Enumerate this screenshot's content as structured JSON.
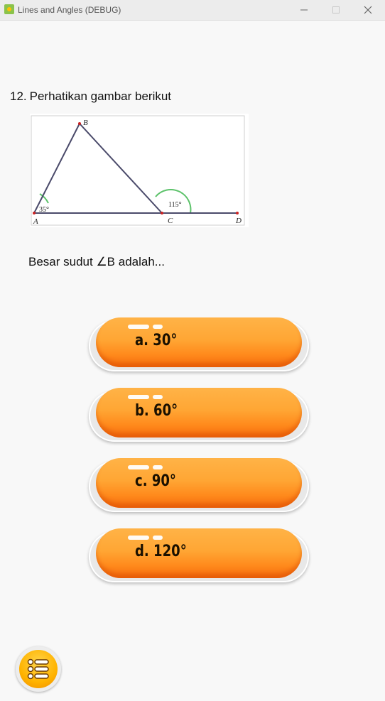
{
  "window": {
    "title": "Lines and Angles (DEBUG)",
    "icons": {
      "app": "app-icon",
      "minimize": "minimize-icon",
      "maximize": "maximize-icon",
      "close": "close-icon"
    }
  },
  "question": {
    "number": "12.",
    "text": "Perhatikan gambar berikut",
    "prompt": "Besar sudut  ∠B adalah..."
  },
  "figure": {
    "points": {
      "A": "A",
      "B": "B",
      "C": "C",
      "D": "D"
    },
    "angle_A": "35°",
    "angle_C_exterior": "115°",
    "arc_color": "#5cc26a",
    "line_color": "#4a4a6a",
    "point_color": "#cc2222"
  },
  "options": [
    {
      "label": "a. 30°"
    },
    {
      "label": "b. 60°"
    },
    {
      "label": "c. 90°"
    },
    {
      "label": "d. 120°"
    }
  ],
  "menu": {
    "icon": "list-menu-icon"
  },
  "colors": {
    "button_orange": "#ff9a2a",
    "menu_yellow": "#ffb300"
  }
}
